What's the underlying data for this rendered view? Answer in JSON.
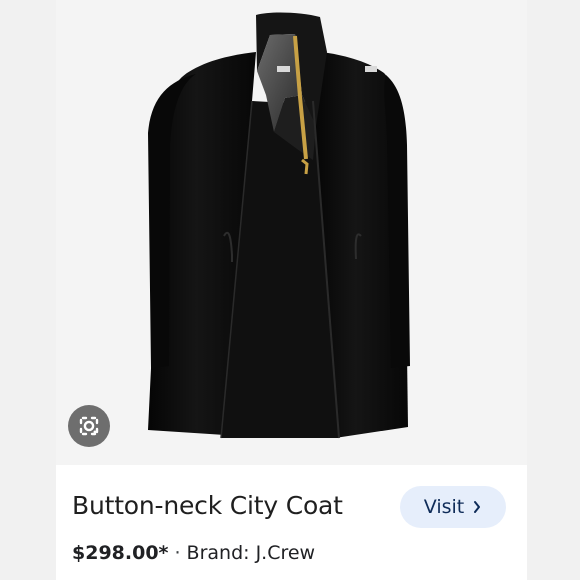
{
  "product": {
    "title": "Button-neck City Coat",
    "price": "$298.00*",
    "brand": "Brand: J.Crew",
    "separator": "·"
  },
  "actions": {
    "visit_label": "Visit"
  },
  "icons": {
    "lens": "google-lens-icon",
    "visit_arrow": "chevron-right-icon"
  },
  "colors": {
    "page_background": "#f1f1f1",
    "image_background": "#f4f4f4",
    "visit_button_background": "#e6eefb",
    "visit_button_text": "#0f2c59",
    "lens_button_background": "#6e6e6e",
    "coat": "#111111",
    "zipper": "#c8a145"
  }
}
